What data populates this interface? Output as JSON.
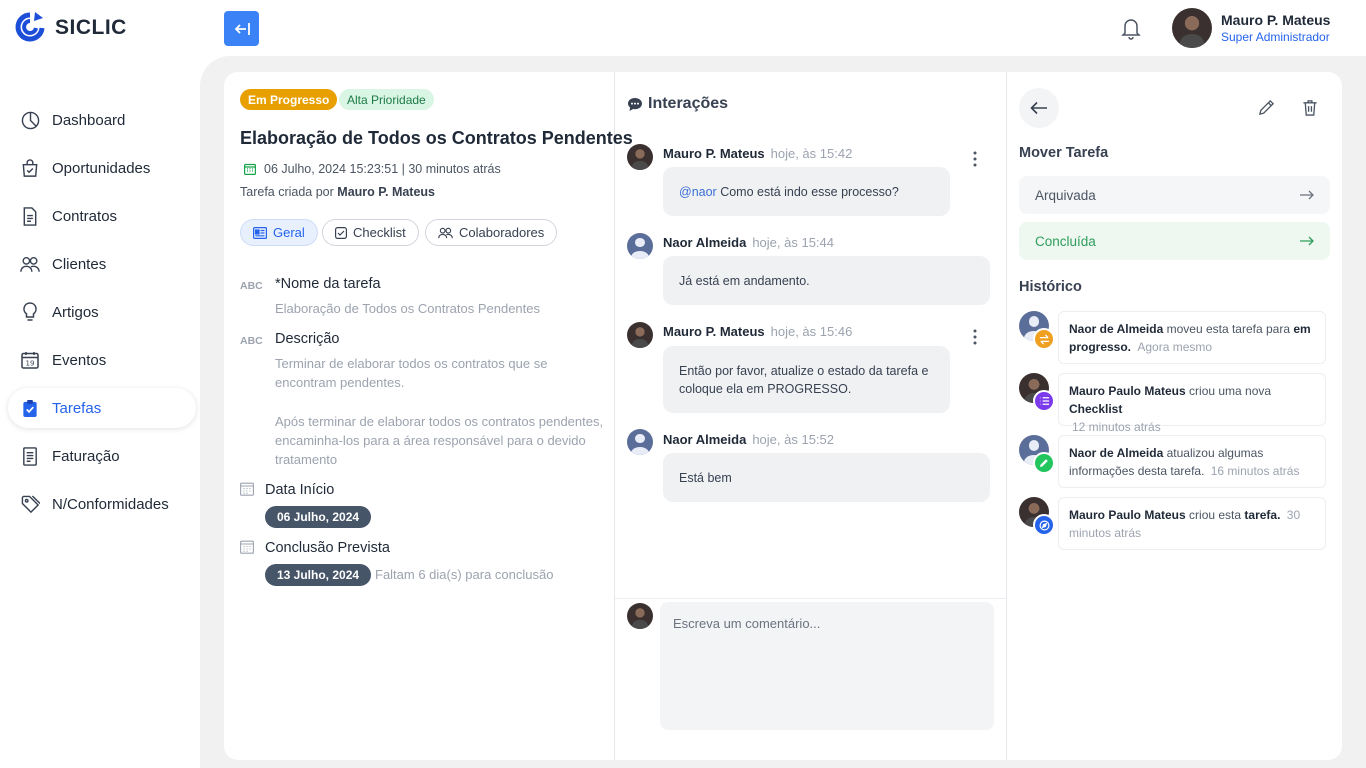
{
  "app": {
    "name": "SICLIC"
  },
  "sidebar": {
    "items": [
      {
        "label": "Dashboard",
        "icon": "pie-chart-icon"
      },
      {
        "label": "Oportunidades",
        "icon": "shopping-bag-icon"
      },
      {
        "label": "Contratos",
        "icon": "document-icon"
      },
      {
        "label": "Clientes",
        "icon": "users-icon"
      },
      {
        "label": "Artigos",
        "icon": "lightbulb-icon"
      },
      {
        "label": "Eventos",
        "icon": "calendar-icon"
      },
      {
        "label": "Tarefas",
        "icon": "clipboard-check-icon",
        "active": true
      },
      {
        "label": "Faturação",
        "icon": "invoice-icon"
      },
      {
        "label": "N/Conformidades",
        "icon": "tag-icon"
      }
    ]
  },
  "topbar": {
    "user_name": "Mauro P. Mateus",
    "user_role": "Super Administrador"
  },
  "task": {
    "status_badge": "Em Progresso",
    "priority_badge": "Alta Prioridade",
    "title": "Elaboração de Todos os Contratos Pendentes",
    "date_line": "06 Julho, 2024 15:23:51 | 30 minutos atrás",
    "created_by_prefix": "Tarefa criada por",
    "created_by": "Mauro P. Mateus",
    "tabs": [
      "Geral",
      "Checklist",
      "Colaboradores"
    ],
    "fields": {
      "abc": "ABC",
      "name_label": "*Nome da tarefa",
      "name_value": "Elaboração de Todos os Contratos Pendentes",
      "desc_label": "Descrição",
      "desc_p1": "Terminar de elaborar todos os contratos que se encontram pendentes.",
      "desc_p2": "Após terminar de elaborar todos os contratos pendentes, encaminha-los para a área responsável para o devido tratamento",
      "start_label": "Data Início",
      "start_value": "06 Julho, 2024",
      "due_label": "Conclusão Prevista",
      "due_value": "13 Julho, 2024",
      "remaining": "Faltam 6 dia(s) para conclusão"
    }
  },
  "interactions": {
    "title": "Interações",
    "messages": [
      {
        "author": "Mauro P. Mateus",
        "time": "hoje, às 15:42",
        "mention": "@naor",
        "text": "Como está indo esse processo?"
      },
      {
        "author": "Naor Almeida",
        "time": "hoje, às 15:44",
        "text": "Já está em andamento."
      },
      {
        "author": "Mauro P. Mateus",
        "time": "hoje, às 15:46",
        "text": "Então por favor, atualize o estado da tarefa e coloque ela em PROGRESSO."
      },
      {
        "author": "Naor Almeida",
        "time": "hoje, às 15:52",
        "text": "Está bem"
      }
    ],
    "comment_placeholder": "Escreva um comentário..."
  },
  "right_panel": {
    "move_title": "Mover Tarefa",
    "move_options": [
      "Arquivada",
      "Concluída"
    ],
    "history_title": "Histórico",
    "history": [
      {
        "actor": "Naor de Almeida",
        "pre": "moveu esta tarefa para",
        "bold": "em progresso.",
        "time": "Agora mesmo",
        "badge_color": "#f0a020"
      },
      {
        "actor": "Mauro Paulo Mateus",
        "pre": "criou uma nova",
        "bold": "Checklist",
        "time": "12 minutos atrás",
        "badge_color": "#7c3aed"
      },
      {
        "actor": "Naor de Almeida",
        "pre": "atualizou algumas informações desta tarefa.",
        "bold": "",
        "time": "16 minutos atrás",
        "badge_color": "#22c55e"
      },
      {
        "actor": "Mauro Paulo Mateus",
        "pre": "criou esta",
        "bold": "tarefa.",
        "time": "30 minutos atrás",
        "badge_color": "#2563eb"
      }
    ]
  }
}
